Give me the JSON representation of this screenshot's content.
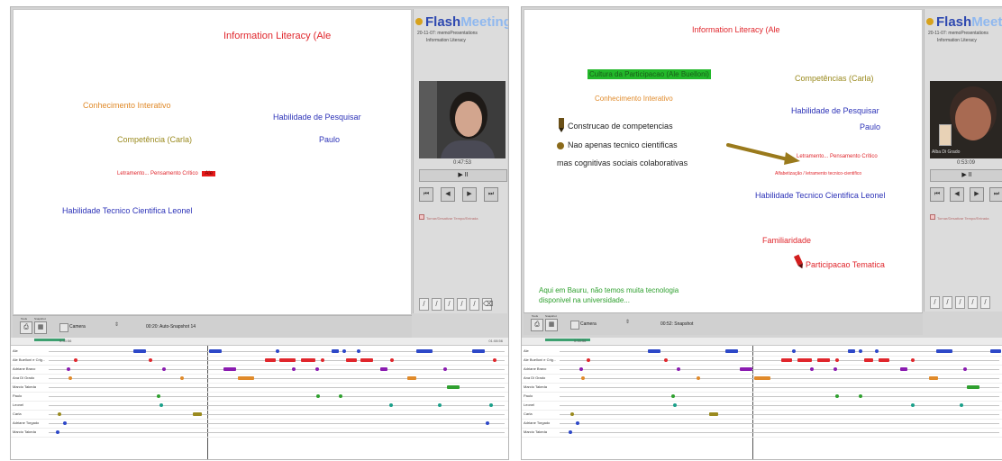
{
  "colors": {
    "red": "#e0262c",
    "blue": "#2d33b8",
    "orange": "#e08a2a",
    "olive": "#9a8a1e",
    "green": "#2fa02f",
    "purple": "#8a1bb0",
    "teal": "#1ba08a"
  },
  "brand": {
    "name_part1": "Flash",
    "name_part2": "Meeting",
    "date": "20-11-07: memoPresentations",
    "subtitle": "Information Literacy"
  },
  "left": {
    "board": {
      "title": "Information Literacy (Ale",
      "conhecimento": "Conhecimento Interativo",
      "habilidade_pesquisar": "Habilidade de Pesquisar",
      "competencia": "Competência (Carla)",
      "paulo": "Paulo",
      "letramento": "Letramento... Pensamento Crítico",
      "letramento_tag": "Ale",
      "habilidade_tecnico": "Habilidade Tecnico Cientifica Leonel"
    },
    "side": {
      "time": "0:47:53",
      "play": "▶ II",
      "checkbox_label": "Tornar/Desativar Tempo/Entrada"
    },
    "bar": {
      "tool_label": "Tools",
      "snap_label": "Snapshot",
      "camera_label": "Camera",
      "status": "00:20: Auto-Snapshot 14"
    }
  },
  "right": {
    "board": {
      "title": "Information Literacy (Ale",
      "cultura": "Cultura da Participacao (Ale Buelloni)",
      "competencias": "Competências (Carla)",
      "conhecimento": "Conhecimento Interativo",
      "construcao": "Construcao de competencias",
      "habilidade_pesquisar": "Habilidade de Pesquisar",
      "paulo": "Paulo",
      "nao_apenas": "Nao apenas tecnico cientificas",
      "cognitivas": "mas cognitivas sociais colaborativas",
      "letramento": "Letramento... Pensamento Crítico",
      "alfabetizacao": "Alfabetização / letramento tecnico-cientifico",
      "habilidade_tecnico": "Habilidade Tecnico Cientifica Leonel",
      "familiaridade": "Familiaridade",
      "participacao": "Participacao Tematica",
      "bauru": "Aqui em Bauru, não temos muita tecnologia",
      "universidade": "disponivel na universidade..."
    },
    "side": {
      "time": "0:53:09",
      "play": "▶ II",
      "checkbox_label": "Tornar/Desativar Tempo/Entrada",
      "video_caption": "Alba Di Grado"
    },
    "bar": {
      "tool_label": "Tools",
      "snap_label": "Snapshot",
      "camera_label": "Camera",
      "status": "00:52: Snapshot"
    }
  },
  "timeline": {
    "left_start": "0:33:56",
    "left_end": "01:08:56",
    "right_start": "0:33:56",
    "participants": [
      "Ale",
      "Ale Buelloni e Crig...",
      "Adriane Bravo",
      "Ana Di Grado",
      "Marcio Takeda",
      "Paulo",
      "Leonel",
      "Carla",
      "Adriane Torgado",
      "Marcio Takeda"
    ]
  }
}
